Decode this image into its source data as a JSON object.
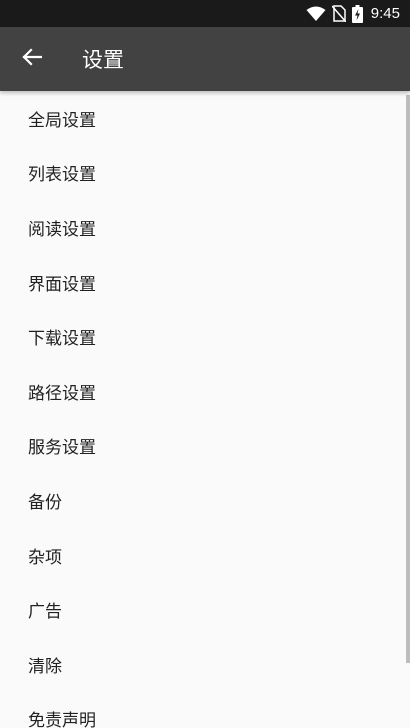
{
  "status_bar": {
    "time": "9:45",
    "icons": [
      "wifi-icon",
      "no-sim-icon",
      "battery-charging-icon"
    ]
  },
  "app_bar": {
    "back_icon": "arrow-left-icon",
    "title": "设置"
  },
  "menu": {
    "items": [
      {
        "label": "全局设置"
      },
      {
        "label": "列表设置"
      },
      {
        "label": "阅读设置"
      },
      {
        "label": "界面设置"
      },
      {
        "label": "下载设置"
      },
      {
        "label": "路径设置"
      },
      {
        "label": "服务设置"
      },
      {
        "label": "备份"
      },
      {
        "label": "杂项"
      },
      {
        "label": "广告"
      },
      {
        "label": "清除"
      },
      {
        "label": "免责声明"
      }
    ]
  },
  "colors": {
    "status_bar_bg": "#1a1a1a",
    "app_bar_bg": "#424242",
    "page_bg": "#fafafa",
    "text": "#212121"
  }
}
